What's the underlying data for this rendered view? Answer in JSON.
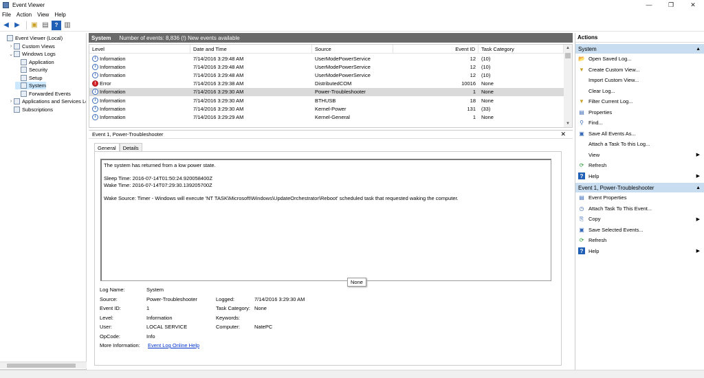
{
  "window": {
    "title": "Event Viewer",
    "minimize": "—",
    "restore": "❐",
    "close": "✕"
  },
  "menu": [
    "File",
    "Action",
    "View",
    "Help"
  ],
  "tree": {
    "items": [
      {
        "label": "Event Viewer (Local)",
        "expander": "",
        "indent": 0
      },
      {
        "label": "Custom Views",
        "expander": "›",
        "indent": 1
      },
      {
        "label": "Windows Logs",
        "expander": "⌄",
        "indent": 1
      },
      {
        "label": "Application",
        "expander": "",
        "indent": 2
      },
      {
        "label": "Security",
        "expander": "",
        "indent": 2
      },
      {
        "label": "Setup",
        "expander": "",
        "indent": 2
      },
      {
        "label": "System",
        "expander": "",
        "indent": 2
      },
      {
        "label": "Forwarded Events",
        "expander": "",
        "indent": 2
      },
      {
        "label": "Applications and Services Lo",
        "expander": "›",
        "indent": 1
      },
      {
        "label": "Subscriptions",
        "expander": "",
        "indent": 1
      }
    ],
    "selected_label": "System"
  },
  "log_header": {
    "name": "System",
    "summary": "Number of events: 8,836 (!) New events available"
  },
  "columns": [
    "Level",
    "Date and Time",
    "Source",
    "Event ID",
    "Task Category"
  ],
  "events": [
    {
      "level": "Information",
      "type": "info",
      "date": "7/14/2016 3:29:48 AM",
      "source": "UserModePowerService",
      "id": "12",
      "category": "(10)"
    },
    {
      "level": "Information",
      "type": "info",
      "date": "7/14/2016 3:29:48 AM",
      "source": "UserModePowerService",
      "id": "12",
      "category": "(10)"
    },
    {
      "level": "Information",
      "type": "info",
      "date": "7/14/2016 3:29:48 AM",
      "source": "UserModePowerService",
      "id": "12",
      "category": "(10)"
    },
    {
      "level": "Error",
      "type": "error",
      "date": "7/14/2016 3:29:38 AM",
      "source": "DistributedCOM",
      "id": "10016",
      "category": "None"
    },
    {
      "level": "Information",
      "type": "info",
      "date": "7/14/2016 3:29:30 AM",
      "source": "Power-Troubleshooter",
      "id": "1",
      "category": "None",
      "selected": true
    },
    {
      "level": "Information",
      "type": "info",
      "date": "7/14/2016 3:29:30 AM",
      "source": "BTHUSB",
      "id": "18",
      "category": "None"
    },
    {
      "level": "Information",
      "type": "info",
      "date": "7/14/2016 3:29:30 AM",
      "source": "Kernel-Power",
      "id": "131",
      "category": "(33)"
    },
    {
      "level": "Information",
      "type": "info",
      "date": "7/14/2016 3:29:29 AM",
      "source": "Kernel-General",
      "id": "1",
      "category": "None"
    }
  ],
  "detail": {
    "title": "Event 1, Power-Troubleshooter",
    "close": "✕",
    "tabs": [
      "General",
      "Details"
    ],
    "message": [
      "The system has returned from a low power state.",
      "",
      "Sleep Time: 2016-07-14T01:50:24.920058400Z",
      "Wake Time: 2016-07-14T07:29:30.139205700Z",
      "",
      "Wake Source: Timer - Windows will execute 'NT TASK\\Microsoft\\Windows\\UpdateOrchestrator\\Reboot' scheduled task that requested waking the computer."
    ],
    "props": {
      "log_name_label": "Log Name:",
      "log_name": "System",
      "source_label": "Source:",
      "source": "Power-Troubleshooter",
      "logged_label": "Logged:",
      "logged": "7/14/2016 3:29:30 AM",
      "event_id_label": "Event ID:",
      "event_id": "1",
      "task_category_label": "Task Category:",
      "task_category": "None",
      "level_label": "Level:",
      "level": "Information",
      "keywords_label": "Keywords:",
      "keywords": "",
      "user_label": "User:",
      "user": "LOCAL SERVICE",
      "computer_label": "Computer:",
      "computer": "NatePC",
      "opcode_label": "OpCode:",
      "opcode": "Info",
      "more_info_label": "More Information:",
      "more_info_link": "Event Log Online Help"
    },
    "tooltip": "None"
  },
  "actions": {
    "header": "Actions",
    "section1": {
      "title": "System",
      "items": [
        {
          "label": "Open Saved Log...",
          "icon": "folder-icon",
          "glyph": "📂",
          "arrow": ""
        },
        {
          "label": "Create Custom View...",
          "icon": "filter-icon",
          "glyph": "▼",
          "arrow": ""
        },
        {
          "label": "Import Custom View...",
          "icon": "",
          "glyph": "",
          "arrow": ""
        },
        {
          "label": "Clear Log...",
          "icon": "",
          "glyph": "",
          "arrow": ""
        },
        {
          "label": "Filter Current Log...",
          "icon": "filter-icon",
          "glyph": "▼",
          "arrow": ""
        },
        {
          "label": "Properties",
          "icon": "properties-icon",
          "glyph": "▤",
          "arrow": ""
        },
        {
          "label": "Find...",
          "icon": "find-icon",
          "glyph": "⚲",
          "arrow": ""
        },
        {
          "label": "Save All Events As...",
          "icon": "save-icon",
          "glyph": "▣",
          "arrow": ""
        },
        {
          "label": "Attach a Task To this Log...",
          "icon": "",
          "glyph": "",
          "arrow": ""
        },
        {
          "label": "View",
          "icon": "",
          "glyph": "",
          "arrow": "▶"
        },
        {
          "label": "Refresh",
          "icon": "refresh-icon",
          "glyph": "⟳",
          "arrow": ""
        },
        {
          "label": "Help",
          "icon": "help-icon",
          "glyph": "?",
          "arrow": "▶"
        }
      ]
    },
    "section2": {
      "title": "Event 1, Power-Troubleshooter",
      "items": [
        {
          "label": "Event Properties",
          "icon": "properties-icon",
          "glyph": "▤",
          "arrow": ""
        },
        {
          "label": "Attach Task To This Event...",
          "icon": "task-icon",
          "glyph": "◷",
          "arrow": ""
        },
        {
          "label": "Copy",
          "icon": "copy-icon",
          "glyph": "⎘",
          "arrow": "▶"
        },
        {
          "label": "Save Selected Events...",
          "icon": "save-icon",
          "glyph": "▣",
          "arrow": ""
        },
        {
          "label": "Refresh",
          "icon": "refresh-icon",
          "glyph": "⟳",
          "arrow": ""
        },
        {
          "label": "Help",
          "icon": "help-icon",
          "glyph": "?",
          "arrow": "▶"
        }
      ]
    },
    "collapse_glyph": "▲"
  },
  "colors": {
    "header_bar": "#696969",
    "action_section": "#c8ddf0",
    "selection": "#cce8ff",
    "error": "#d8232a",
    "info": "#3869b8"
  }
}
